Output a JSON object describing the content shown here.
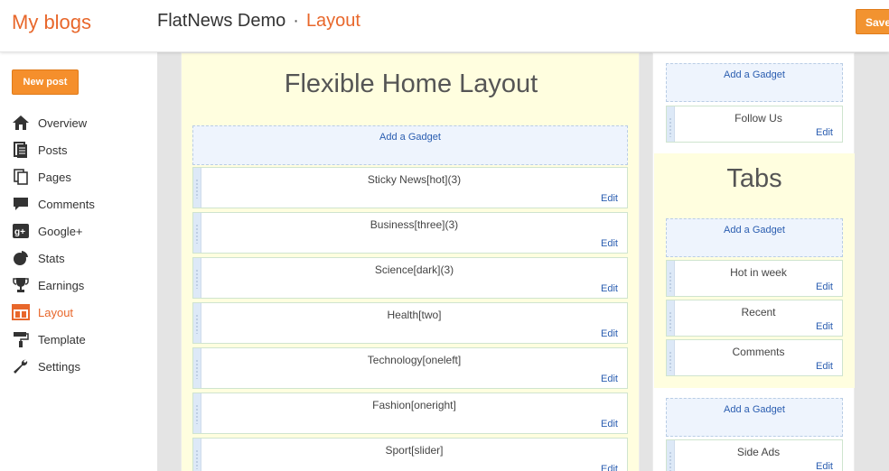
{
  "header": {
    "brand": "My blogs",
    "blog_name": "FlatNews Demo",
    "separator": "·",
    "current_page": "Layout",
    "save_label": "Save"
  },
  "sidebar": {
    "new_post_label": "New post",
    "items": [
      {
        "label": "Overview",
        "icon": "home-icon"
      },
      {
        "label": "Posts",
        "icon": "posts-icon"
      },
      {
        "label": "Pages",
        "icon": "pages-icon"
      },
      {
        "label": "Comments",
        "icon": "comment-icon"
      },
      {
        "label": "Google+",
        "icon": "google-plus-icon"
      },
      {
        "label": "Stats",
        "icon": "pie-chart-icon"
      },
      {
        "label": "Earnings",
        "icon": "trophy-icon"
      },
      {
        "label": "Layout",
        "icon": "layout-icon",
        "active": true
      },
      {
        "label": "Template",
        "icon": "paint-roller-icon"
      },
      {
        "label": "Settings",
        "icon": "wrench-icon"
      }
    ]
  },
  "main": {
    "title": "Flexible Home Layout",
    "add_gadget_label": "Add a Gadget",
    "gadgets": [
      {
        "name": "Sticky News[hot](3)",
        "edit": "Edit"
      },
      {
        "name": "Business[three](3)",
        "edit": "Edit"
      },
      {
        "name": "Science[dark](3)",
        "edit": "Edit"
      },
      {
        "name": "Health[two]",
        "edit": "Edit"
      },
      {
        "name": "Technology[oneleft]",
        "edit": "Edit"
      },
      {
        "name": "Fashion[oneright]",
        "edit": "Edit"
      },
      {
        "name": "Sport[slider]",
        "edit": "Edit"
      }
    ]
  },
  "side": {
    "top_add_gadget": "Add a Gadget",
    "follow": {
      "name": "Follow Us",
      "edit": "Edit"
    },
    "tabs_title": "Tabs",
    "tabs_add_gadget": "Add a Gadget",
    "tabs_gadgets": [
      {
        "name": "Hot in week",
        "edit": "Edit"
      },
      {
        "name": "Recent",
        "edit": "Edit"
      },
      {
        "name": "Comments",
        "edit": "Edit"
      }
    ],
    "bottom_add_gadget": "Add a Gadget",
    "side_ads": {
      "name": "Side Ads",
      "edit": "Edit"
    }
  },
  "colors": {
    "accent": "#e8672b",
    "button": "#f58f2c",
    "link": "#2a5db0",
    "section_bg": "#fffedf"
  }
}
